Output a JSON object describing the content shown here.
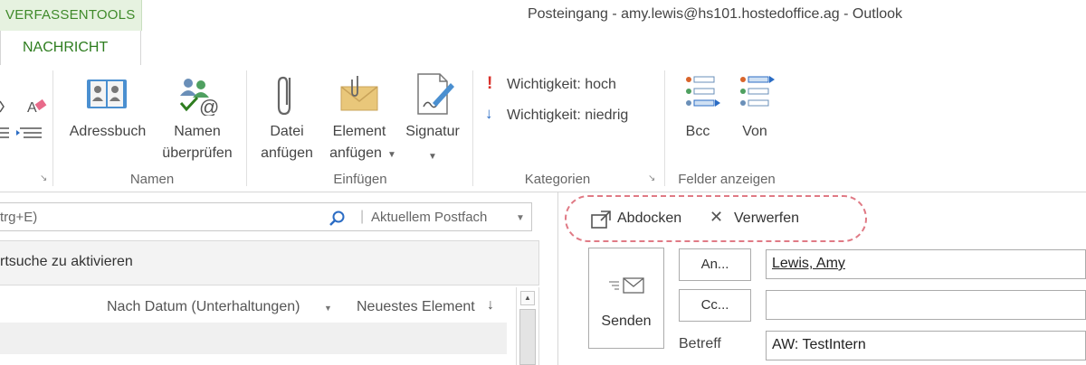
{
  "window": {
    "title": "Posteingang - amy.lewis@hs101.hostedoffice.ag - Outlook"
  },
  "ribbon": {
    "context_tab": "VERFASSENTOOLS",
    "active_tab": "NACHRICHT",
    "buttons": {
      "address_book": "Adressbuch",
      "check_names_1": "Namen",
      "check_names_2": "überprüfen",
      "attach_file_1": "Datei",
      "attach_file_2": "anfügen",
      "attach_item_1": "Element",
      "attach_item_2": "anfügen",
      "signature": "Signatur",
      "importance_high": "Wichtigkeit: hoch",
      "importance_low": "Wichtigkeit: niedrig",
      "bcc": "Bcc",
      "from": "Von"
    },
    "groups": {
      "names": "Namen",
      "include": "Einfügen",
      "tags": "Kategorien",
      "show_fields": "Felder anzeigen"
    }
  },
  "search": {
    "placeholder_fragment": "trg+E)",
    "scope": "Aktuellem Postfach"
  },
  "notice": {
    "text": "rtsuche zu aktivieren"
  },
  "list": {
    "sort_by": "Nach Datum (Unterhaltungen)",
    "order": "Neuestes Element",
    "order_arrow": "↓"
  },
  "compose": {
    "popout": "Abdocken",
    "discard": "Verwerfen",
    "send": "Senden",
    "to_button": "An...",
    "cc_button": "Cc...",
    "to_value": "Lewis, Amy",
    "subject_label": "Betreff",
    "subject_value": "AW: TestIntern"
  },
  "colors": {
    "accent_green": "#2e7d1f",
    "context_tab_bg": "#e6f2e0",
    "annotation_oval": "#e07a85",
    "importance_high": "#d9312b",
    "importance_low": "#2b6cc4"
  }
}
